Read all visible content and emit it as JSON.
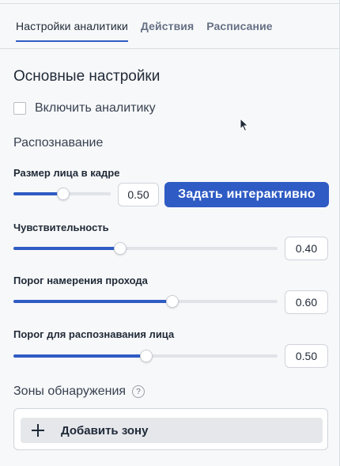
{
  "tabs": [
    {
      "label": "Настройки аналитики",
      "active": true
    },
    {
      "label": "Действия",
      "active": false
    },
    {
      "label": "Расписание",
      "active": false
    }
  ],
  "main": {
    "section_title": "Основные настройки",
    "enable_analytics": {
      "label": "Включить аналитику",
      "checked": false
    },
    "recognition_title": "Распознавание",
    "face_size": {
      "label": "Размер лица в кадре",
      "value": "0.50",
      "fraction": 0.5,
      "interactive_button": "Задать интерактивно"
    },
    "sensitivity": {
      "label": "Чувствительность",
      "value": "0.40",
      "fraction": 0.4
    },
    "pass_intent": {
      "label": "Порог намерения прохода",
      "value": "0.60",
      "fraction": 0.6
    },
    "face_threshold": {
      "label": "Порог для распознавания лица",
      "value": "0.50",
      "fraction": 0.5
    },
    "zones": {
      "title": "Зоны обнаружения",
      "help_icon": "?",
      "add_button": "Добавить зону"
    }
  },
  "colors": {
    "accent": "#2f5bc4",
    "track": "#e0e3e8"
  }
}
